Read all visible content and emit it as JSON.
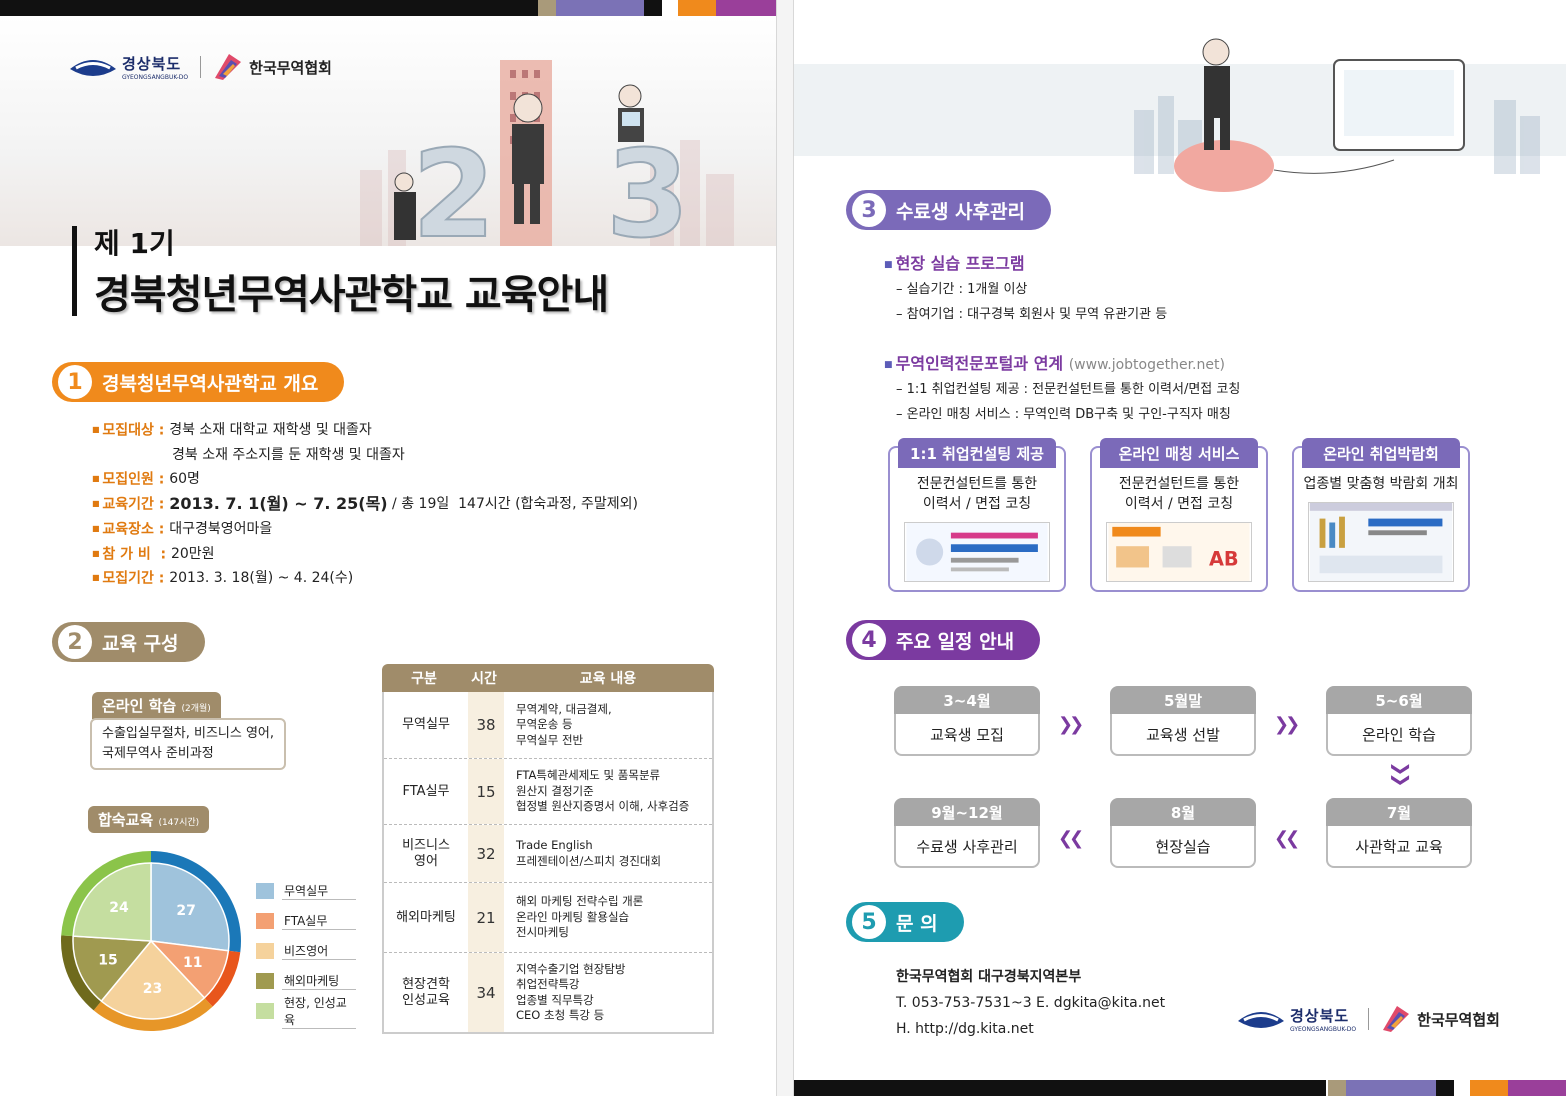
{
  "colors": {
    "orange": "#f08a1c",
    "tan": "#a08c6a",
    "purple": "#7b3aa0",
    "teal": "#1e9cb0",
    "navy": "#1c2d6b"
  },
  "logos": {
    "gb_kr": "경상북도",
    "gb_en": "GYEONGSANGBUK-DO",
    "kita": "한국무역협회"
  },
  "title": {
    "small": "제 1기",
    "big": "경북청년무역사관학교 교육안내"
  },
  "sec1": {
    "num": "1",
    "label": "경북청년무역사관학교 개요",
    "rows": [
      {
        "k": "모집대상 : ",
        "v": "경북 소재 대학교 재학생 및 대졸자"
      },
      {
        "k": "",
        "v": "경북 소재 주소지를 둔 재학생 및 대졸자"
      },
      {
        "k": "모집인원 : ",
        "v": "60명"
      },
      {
        "k": "교육기간 : ",
        "v": "2013. 7. 1(월) ~ 7. 25(목)",
        "v2": " / 총 19일  147시간 (합숙과정, 주말제외)"
      },
      {
        "k": "교육장소 : ",
        "v": "대구경북영어마을"
      },
      {
        "k": "참 가 비  : ",
        "v": "20만원"
      },
      {
        "k": "모집기간 : ",
        "v": "2013. 3. 18(월) ~ 4. 24(수)"
      }
    ]
  },
  "sec2": {
    "num": "2",
    "label": "교육 구성",
    "online": {
      "label": "온라인 학습",
      "sub": "(2개월)",
      "line1": "수출입실무절차, 비즈니스 영어,",
      "line2": "국제무역사 준비과정"
    },
    "camp": {
      "label": "합숙교육",
      "sub": "(147시간)"
    },
    "legend": [
      "무역실무",
      "FTA실무",
      "비즈영어",
      "해외마케팅",
      "현장, 인성교육"
    ],
    "table": {
      "headers": [
        "구분",
        "시간",
        "교육 내용"
      ],
      "rows": [
        {
          "name": "무역실무",
          "hours": "38",
          "items": [
            "무역계약, 대금결제,",
            "무역운송 등",
            "무역실무 전반"
          ]
        },
        {
          "name": "FTA실무",
          "hours": "15",
          "items": [
            "FTA특혜관세제도 및 품목분류",
            "원산지 결정기준",
            "협정별 원산지증명서 이해, 사후검증"
          ]
        },
        {
          "name": "비즈니스\n영어",
          "hours": "32",
          "items": [
            "Trade English",
            "프레젠테이션/스피치 경진대회"
          ]
        },
        {
          "name": "해외마케팅",
          "hours": "21",
          "items": [
            "해외 마케팅 전략수립 개론",
            "온라인 마케팅 활용실습",
            "전시마케팅"
          ]
        },
        {
          "name": "현장견학\n인성교육",
          "hours": "34",
          "items": [
            "지역수출기업 현장탐방",
            "취업전략특강",
            "업종별 직무특강",
            "CEO 초청 특강 등"
          ]
        }
      ]
    }
  },
  "chart_data": {
    "type": "pie",
    "categories": [
      "무역실무",
      "FTA실무",
      "비즈영어",
      "해외마케팅",
      "현장, 인성교육"
    ],
    "values": [
      27,
      11,
      23,
      15,
      24
    ],
    "colors": [
      "#9fc3dc",
      "#f3a073",
      "#f5d29c",
      "#a09a50",
      "#c5dea0"
    ],
    "rim_colors": [
      "#1b78b8",
      "#e8561c",
      "#e79628",
      "#6f6a1c",
      "#8bc44a"
    ],
    "legend_position": "right"
  },
  "sec3": {
    "num": "3",
    "label": "수료생 사후관리",
    "sub1": {
      "title": "현장 실습 프로그램",
      "lines": [
        "– 실습기간 : 1개월 이상",
        "– 참여기업 : 대구경북 회원사 및 무역 유관기관 등"
      ]
    },
    "sub2": {
      "title": "무역인력전문포털과 연계",
      "url": "(www.jobtogether.net)",
      "lines": [
        "– 1:1 취업컨설팅 제공 : 전문컨설턴트를 통한 이력서/면접 코칭",
        "– 온라인 매칭 서비스 : 무역인력 DB구축 및 구인-구직자 매칭"
      ]
    },
    "services": [
      {
        "title": "1:1 취업컨설팅 제공",
        "desc1": "전문컨설턴트를 통한",
        "desc2": "이력서 / 면접 코칭"
      },
      {
        "title": "온라인 매칭 서비스",
        "desc1": "전문컨설턴트를 통한",
        "desc2": "이력서 / 면접 코칭"
      },
      {
        "title": "온라인 취업박람회",
        "desc1": "업종별 맞춤형 박람회 개최",
        "desc2": ""
      }
    ]
  },
  "sec4": {
    "num": "4",
    "label": "주요 일정 안내",
    "steps": [
      {
        "when": "3~4월",
        "what": "교육생 모집"
      },
      {
        "when": "5월말",
        "what": "교육생 선발"
      },
      {
        "when": "5~6월",
        "what": "온라인 학습"
      },
      {
        "when": "7월",
        "what": "사관학교 교육"
      },
      {
        "when": "8월",
        "what": "현장실습"
      },
      {
        "when": "9월~12월",
        "what": "수료생 사후관리"
      }
    ]
  },
  "sec5": {
    "num": "5",
    "label": "문  의",
    "org": "한국무역협회 대구경북지역본부",
    "tel": "T. 053-753-7531~3   E. dgkita@kita.net",
    "web": "H. http://dg.kita.net"
  }
}
